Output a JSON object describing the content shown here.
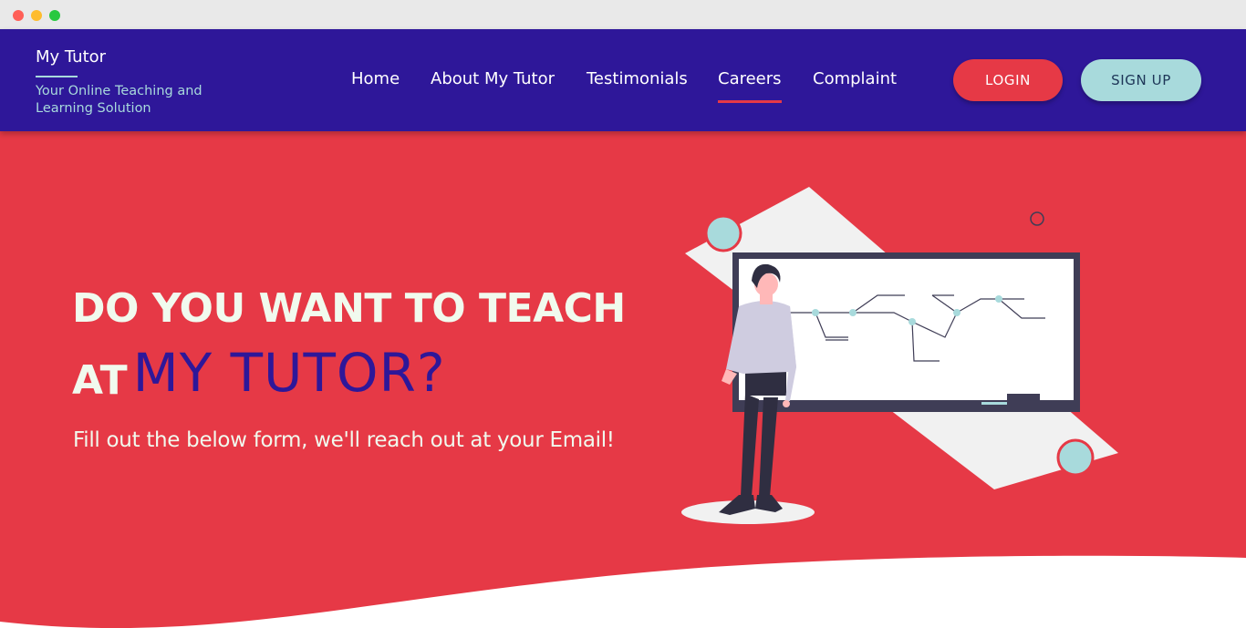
{
  "window": {
    "controls": [
      "close",
      "minimize",
      "maximize"
    ]
  },
  "brand": {
    "name": "My Tutor",
    "tagline": "Your Online Teaching and Learning Solution"
  },
  "nav": {
    "items": [
      {
        "label": "Home",
        "active": false
      },
      {
        "label": "About My Tutor",
        "active": false
      },
      {
        "label": "Testimonials",
        "active": false
      },
      {
        "label": "Careers",
        "active": true
      },
      {
        "label": "Complaint",
        "active": false
      }
    ],
    "login_label": "LOGIN",
    "signup_label": "SIGN UP"
  },
  "hero": {
    "title_line1": "DO YOU WANT TO TEACH",
    "title_line2_prefix": "AT",
    "title_line2_accent": "MY TUTOR?",
    "subtitle": "Fill out the below form, we'll reach out at your Email!"
  },
  "colors": {
    "navbar": "#2e1799",
    "hero_bg": "#e63946",
    "accent_teal": "#a8dadc",
    "text_light": "#f1faee",
    "dark": "#1d3557"
  },
  "illustration": {
    "name": "teacher-at-whiteboard"
  }
}
